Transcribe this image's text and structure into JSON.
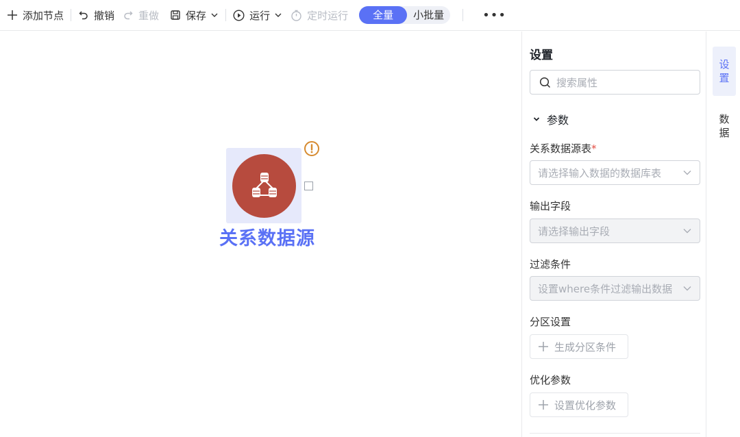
{
  "toolbar": {
    "add_node": "添加节点",
    "undo": "撤销",
    "redo": "重做",
    "save": "保存",
    "run": "运行",
    "schedule_run": "定时运行",
    "mode_full": "全量",
    "mode_small_batch": "小批量",
    "more": "•••"
  },
  "canvas": {
    "node": {
      "label": "关系数据源",
      "icon": "relational-database-icon",
      "status": "warning",
      "accent_color": "#5a71f5",
      "node_color": "#b74b3e"
    }
  },
  "panel": {
    "title": "设置",
    "search_placeholder": "搜索属性",
    "section": "参数",
    "fields": {
      "source_table": {
        "label": "关系数据源表",
        "required_mark": "*",
        "placeholder": "请选择输入数据的数据库表"
      },
      "output_fields": {
        "label": "输出字段",
        "placeholder": "请选择输出字段"
      },
      "filter": {
        "label": "过滤条件",
        "placeholder": "设置where条件过滤输出数据"
      },
      "partition": {
        "label": "分区设置",
        "button": "生成分区条件"
      },
      "optimize": {
        "label": "优化参数",
        "button": "设置优化参数"
      }
    }
  },
  "rail": {
    "tab_settings": [
      "设",
      "置"
    ],
    "tab_data": [
      "数",
      "据"
    ]
  }
}
